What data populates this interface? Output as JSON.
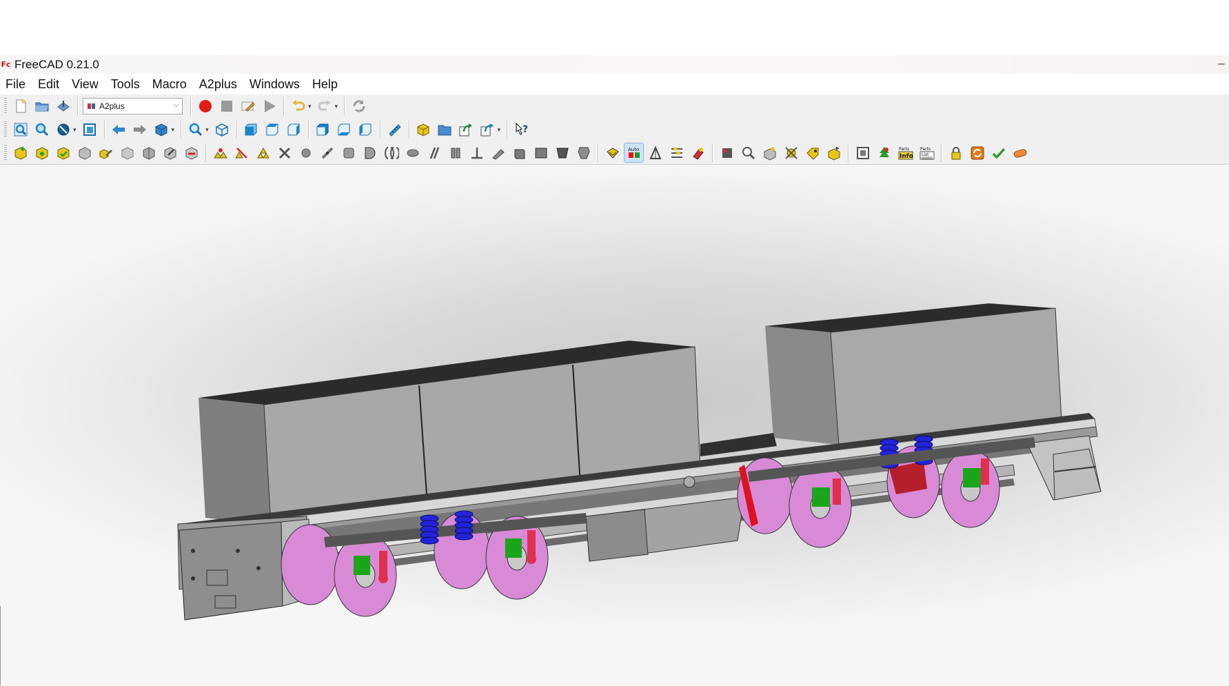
{
  "window": {
    "title": "FreeCAD 0.21.0",
    "app_logo_text": "Fc",
    "minimize_glyph": "–"
  },
  "menubar": {
    "items": [
      "File",
      "Edit",
      "View",
      "Tools",
      "Macro",
      "A2plus",
      "Windows",
      "Help"
    ]
  },
  "toolbar_file": {
    "workbench_selector": {
      "value": "A2plus"
    },
    "icons": [
      "new-document-icon",
      "open-folder-icon",
      "save-icon",
      "macro-record-icon",
      "macro-stop-icon",
      "macro-edit-icon",
      "macro-run-icon",
      "undo-icon",
      "redo-icon",
      "refresh-icon"
    ]
  },
  "toolbar_view": {
    "icons": [
      "fit-all-icon",
      "fit-selection-icon",
      "draw-style-icon",
      "bounding-box-icon",
      "back-nav-icon",
      "forward-nav-icon",
      "std-views-icon",
      "zoom-icon",
      "isometric-icon",
      "front-view-icon",
      "top-view-icon",
      "right-view-icon",
      "rear-view-icon",
      "bottom-view-icon",
      "left-view-icon",
      "measure-icon",
      "part-icon",
      "group-folder-icon",
      "link-make-icon",
      "link-actions-icon",
      "whats-this-icon"
    ]
  },
  "toolbar_a2plus": {
    "auto_label": "Auto",
    "parts_info_label_top": "Parts",
    "parts_info_label_bottom": "Info",
    "parts_list_label_top": "Parts",
    "parts_list_label_bottom": "List"
  },
  "colors": {
    "record_red": "#e01919",
    "a2plus_yellow": "#e8c51a",
    "view_blue": "#1a86c9",
    "box_top": "#2b2b2b",
    "box_side": "#a7a7a7",
    "wheel_pink": "#d88ad6",
    "spring_blue": "#2323d8",
    "damper_red": "#e0304f",
    "green_part": "#1aa51a"
  }
}
